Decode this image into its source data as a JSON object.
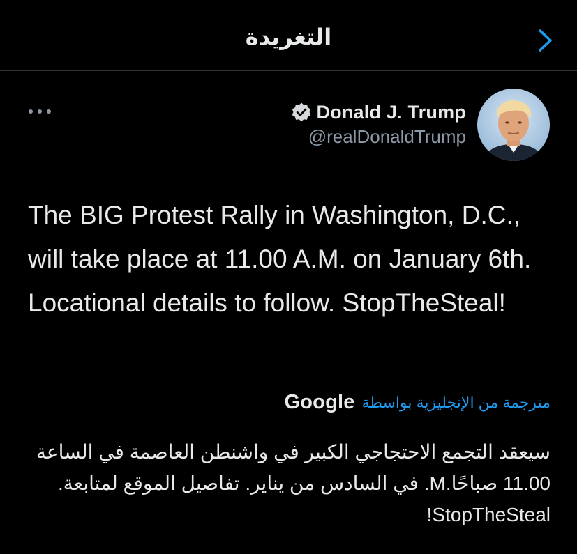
{
  "header": {
    "title": "التغريدة",
    "back_icon": "chevron-right-icon"
  },
  "tweet": {
    "author": {
      "display_name": "Donald J. Trump",
      "handle": "@realDonaldTrump",
      "verified": true,
      "avatar_icon": "user-avatar"
    },
    "more_icon": "more-options-icon",
    "text": "The BIG Protest Rally in Washington, D.C., will take place at 11.00 A.M. on January 6th. Locational details to follow. StopTheSteal!",
    "translation": {
      "provider": "Google",
      "label": "مترجمة من الإنجليزية بواسطة",
      "text": "سيعقد التجمع الاحتجاجي الكبير في واشنطن العاصمة في الساعة 11.00 صباحًا.M. في السادس من يناير. تفاصيل الموقع لمتابعة. StopTheSteal!"
    }
  },
  "colors": {
    "background": "#000000",
    "primary_text": "#e7e9ea",
    "secondary_text": "#8b98a5",
    "accent": "#1d9bf0",
    "divider": "#2f3336"
  }
}
